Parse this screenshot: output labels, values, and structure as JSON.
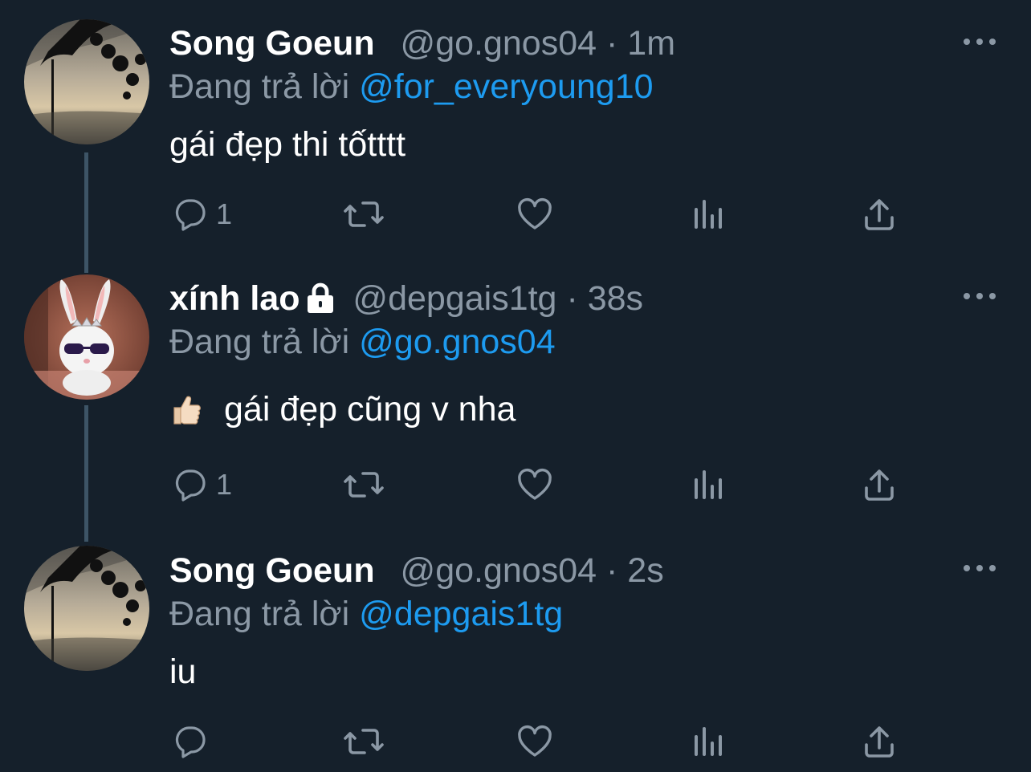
{
  "colors": {
    "background": "#15202b",
    "secondary_text": "#8b98a5",
    "accent": "#1d9bf0",
    "thread_line": "#3d5466"
  },
  "tweets": [
    {
      "display_name": "Song Goeun",
      "handle": "@go.gnos04",
      "separator": "·",
      "time": "1m",
      "replying_prefix": "Đang trả lời",
      "replying_to": "@for_everyoung10",
      "text": "gái đẹp thi tốtttt",
      "reply_count": "1",
      "avatar_icon": "tree-silhouette-avatar",
      "protected": false
    },
    {
      "display_name": "xính lao",
      "handle": "@depgais1tg",
      "separator": "·",
      "time": "38s",
      "replying_prefix": "Đang trả lời",
      "replying_to": "@go.gnos04",
      "emoji_icon": "thumbs-up-emoji",
      "text": "gái đẹp cũng v nha",
      "reply_count": "1",
      "avatar_icon": "bunny-sunglasses-avatar",
      "protected": true
    },
    {
      "display_name": "Song Goeun",
      "handle": "@go.gnos04",
      "separator": "·",
      "time": "2s",
      "replying_prefix": "Đang trả lời",
      "replying_to": "@depgais1tg",
      "text": "iu",
      "reply_count": "",
      "avatar_icon": "tree-silhouette-avatar",
      "protected": false
    }
  ]
}
